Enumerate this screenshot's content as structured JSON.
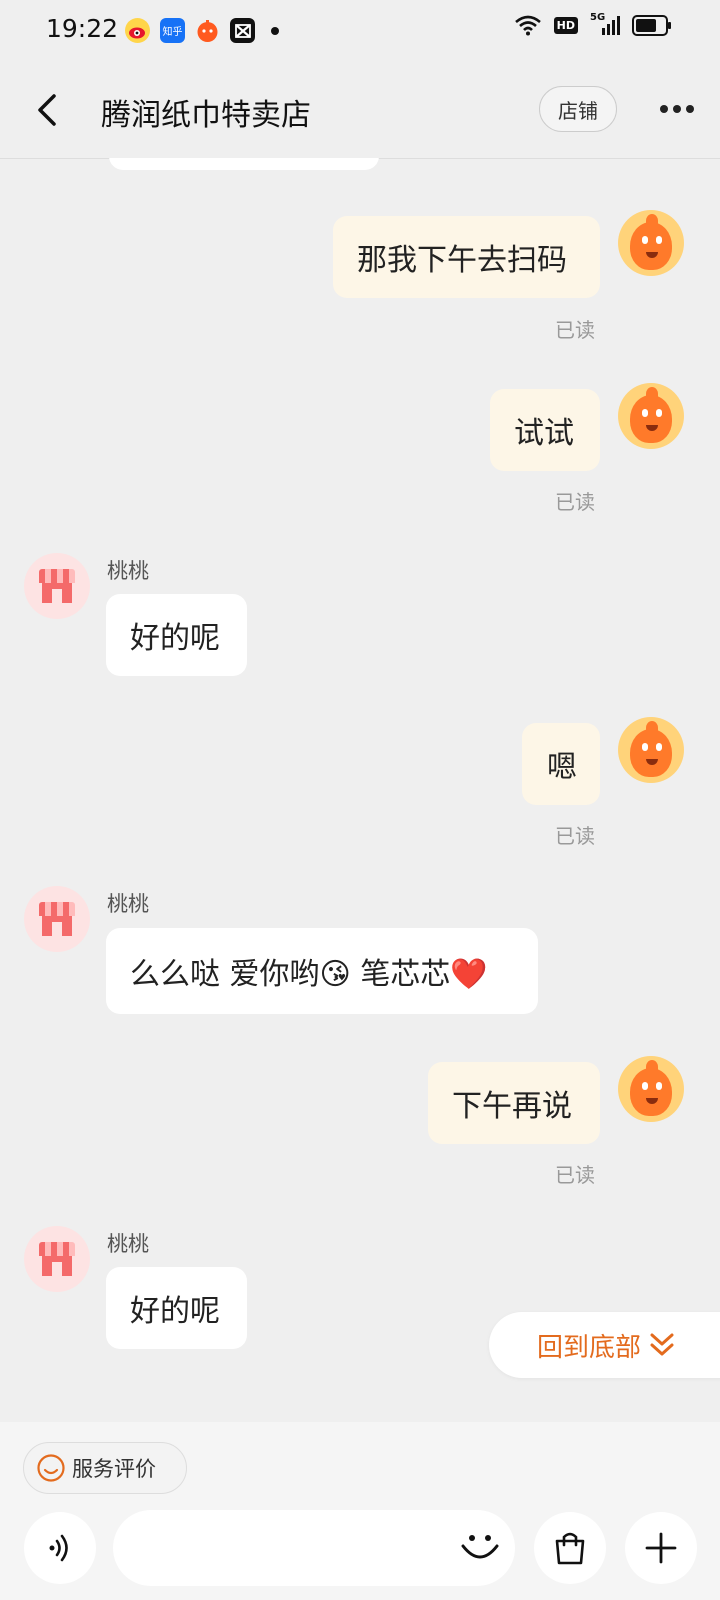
{
  "status_bar": {
    "time": "19:22",
    "app_icons": [
      "weibo-icon",
      "zhihu-icon",
      "taobao-icon",
      "capcut-icon"
    ],
    "zhihu_text": "知乎",
    "network": "5G",
    "hd_label": "HD",
    "battery_level": 0.75
  },
  "header": {
    "title": "腾润纸巾特卖店",
    "shop_button": "店铺"
  },
  "messages": [
    {
      "side": "mine",
      "text": "那我下午去扫码",
      "status": "已读"
    },
    {
      "side": "mine",
      "text": "试试",
      "status": "已读"
    },
    {
      "side": "theirs",
      "sender": "桃桃",
      "text": "好的呢"
    },
    {
      "side": "mine",
      "text": "嗯",
      "status": "已读"
    },
    {
      "side": "theirs",
      "sender": "桃桃",
      "text": "么么哒 爱你哟😘  笔芯芯❤️"
    },
    {
      "side": "mine",
      "text": "下午再说",
      "status": "已读"
    },
    {
      "side": "theirs",
      "sender": "桃桃",
      "text": "好的呢"
    }
  ],
  "back_to_bottom": "回到底部",
  "footer": {
    "rate_label": "服务评价",
    "input_placeholder": ""
  },
  "colors": {
    "accent": "#e36b1e",
    "my_bubble": "#fdf6e7",
    "their_bubble": "#ffffff",
    "chat_bg": "#efefef"
  }
}
